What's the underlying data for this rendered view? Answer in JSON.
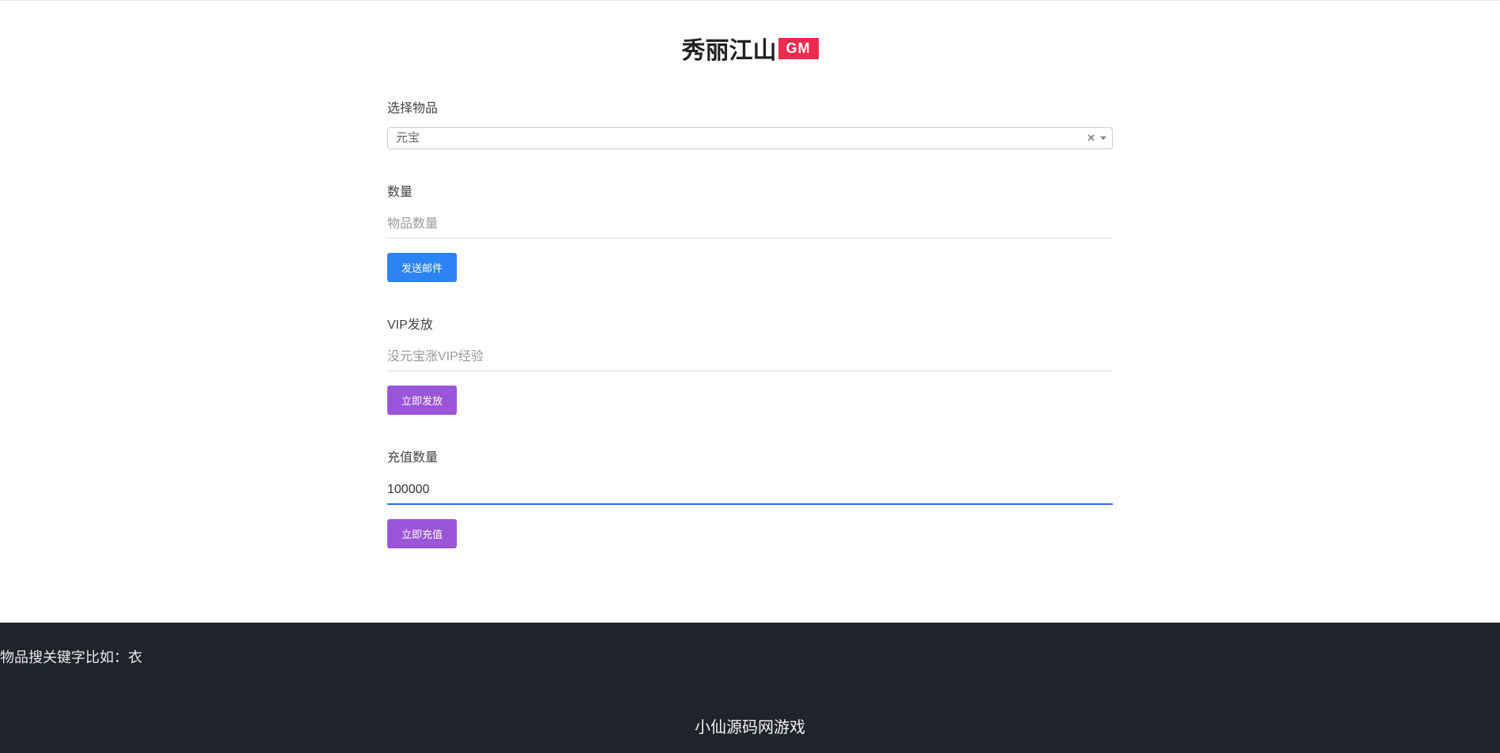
{
  "header": {
    "title": "秀丽江山",
    "badge": "GM"
  },
  "form": {
    "select_item": {
      "label": "选择物品",
      "selected": "元宝"
    },
    "quantity": {
      "label": "数量",
      "placeholder": "物品数量",
      "value": ""
    },
    "send_mail_button": "发送邮件",
    "vip_grant": {
      "label": "VIP发放",
      "placeholder": "没元宝涨VIP经验",
      "value": ""
    },
    "grant_now_button": "立即发放",
    "recharge_amount": {
      "label": "充值数量",
      "placeholder": "",
      "value": "100000"
    },
    "recharge_now_button": "立即充值"
  },
  "footer": {
    "hint": "物品搜关键字比如：衣",
    "brand": "小仙源码网游戏"
  }
}
